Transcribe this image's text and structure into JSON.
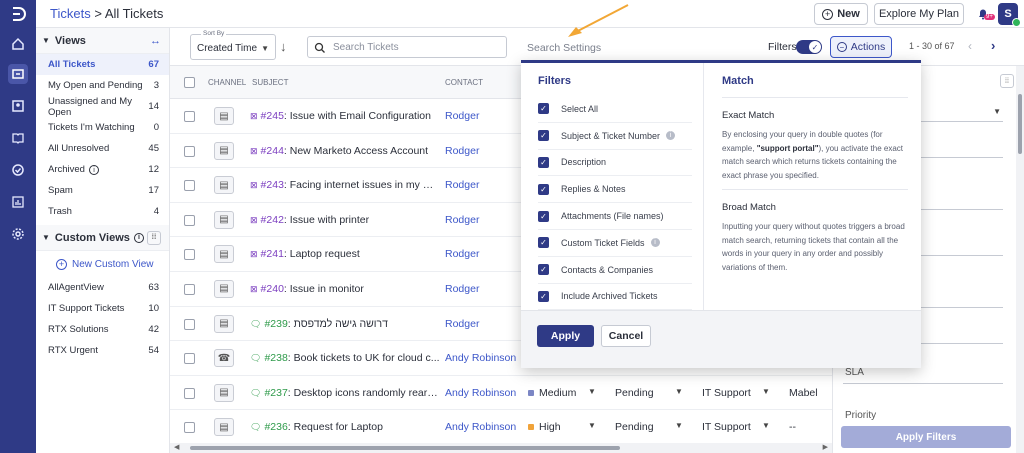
{
  "breadcrumb": {
    "root": "Tickets",
    "separator": " > ",
    "current": "All Tickets"
  },
  "topbar": {
    "new_label": "New",
    "explore_label": "Explore My Plan",
    "notif_badge": "9+",
    "avatar_initial": "S"
  },
  "sidebar": {
    "views_title": "Views",
    "views": [
      {
        "label": "All Tickets",
        "count": "67",
        "active": true
      },
      {
        "label": "My Open and Pending",
        "count": "3"
      },
      {
        "label": "Unassigned and My Open",
        "count": "14"
      },
      {
        "label": "Tickets I'm Watching",
        "count": "0"
      },
      {
        "label": "All Unresolved",
        "count": "45"
      },
      {
        "label": "Archived",
        "count": "12"
      },
      {
        "label": "Spam",
        "count": "17"
      },
      {
        "label": "Trash",
        "count": "4"
      }
    ],
    "custom_title": "Custom Views",
    "new_custom_label": "New Custom View",
    "custom_views": [
      {
        "label": "AllAgentView",
        "count": "63"
      },
      {
        "label": "IT Support Tickets",
        "count": "10"
      },
      {
        "label": "RTX Solutions",
        "count": "42"
      },
      {
        "label": "RTX Urgent",
        "count": "54"
      }
    ]
  },
  "toolbar": {
    "sort_caption": "Sort By",
    "sort_value": "Created Time",
    "search_placeholder": "Search Tickets",
    "search_settings": "Search Settings",
    "filters_label": "Filters",
    "actions_label": "Actions",
    "pagination": "1 - 30 of 67"
  },
  "columns": {
    "channel": "CHANNEL",
    "subject": "SUBJECT",
    "contact": "CONTACT"
  },
  "tickets": [
    {
      "num": "#245",
      "subject": ": Issue with Email Configuration",
      "contact": "Rodger",
      "kind": "email"
    },
    {
      "num": "#244",
      "subject": ": New Marketo Access Account",
      "contact": "Rodger",
      "kind": "email"
    },
    {
      "num": "#243",
      "subject": ": Facing internet issues in my M...",
      "contact": "Rodger",
      "kind": "email"
    },
    {
      "num": "#242",
      "subject": ": Issue with printer",
      "contact": "Rodger",
      "kind": "email"
    },
    {
      "num": "#241",
      "subject": ": Laptop request",
      "contact": "Rodger",
      "kind": "email"
    },
    {
      "num": "#240",
      "subject": ": Issue in monitor",
      "contact": "Rodger",
      "kind": "email"
    },
    {
      "num": "#239",
      "subject": ": דרושה גישה למדפסת",
      "contact": "Rodger",
      "kind": "chat"
    },
    {
      "num": "#238",
      "subject": ": Book tickets to UK for cloud c...",
      "contact": "Andy Robinson",
      "kind": "chat",
      "channel": "phone"
    },
    {
      "num": "#237",
      "subject": ": Desktop icons randomly rearra...",
      "contact": "Andy Robinson",
      "kind": "chat",
      "priority": "Medium",
      "priority_color": "#7b86c4",
      "status": "Pending",
      "group": "IT Support",
      "agent": "Mabel"
    },
    {
      "num": "#236",
      "subject": ": Request for Laptop",
      "contact": "Andy Robinson",
      "kind": "chat",
      "priority": "High",
      "priority_color": "#f0a33a",
      "status": "Pending",
      "group": "IT Support",
      "agent": "--"
    }
  ],
  "filters_popup": {
    "filters_title": "Filters",
    "match_title": "Match",
    "items": [
      {
        "label": "Select All",
        "info": false
      },
      {
        "label": "Subject & Ticket Number",
        "info": true
      },
      {
        "label": "Description",
        "info": false
      },
      {
        "label": "Replies & Notes",
        "info": false
      },
      {
        "label": "Attachments (File names)",
        "info": false
      },
      {
        "label": "Custom Ticket Fields",
        "info": true
      },
      {
        "label": "Contacts & Companies",
        "info": false
      },
      {
        "label": "Include Archived Tickets",
        "info": false
      }
    ],
    "exact_title": "Exact Match",
    "exact_pre": "By enclosing your query in double quotes (for example, ",
    "exact_bold": "\"support portal\"",
    "exact_post": "), you activate the exact match search which returns tickets containing the exact phrase you specified.",
    "broad_title": "Broad Match",
    "broad_text": "Inputting your query without quotes triggers a broad match search, returning tickets that contain all the words in your query in any order and possibly variations of them.",
    "apply_label": "Apply",
    "cancel_label": "Cancel"
  },
  "right_panel": {
    "sla_label": "SLA",
    "priority_label": "Priority",
    "apply_filters_label": "Apply Filters"
  },
  "colors": {
    "primary": "#2f3a86",
    "link": "#3d57c9",
    "annotation_arrow": "#f2a735"
  }
}
